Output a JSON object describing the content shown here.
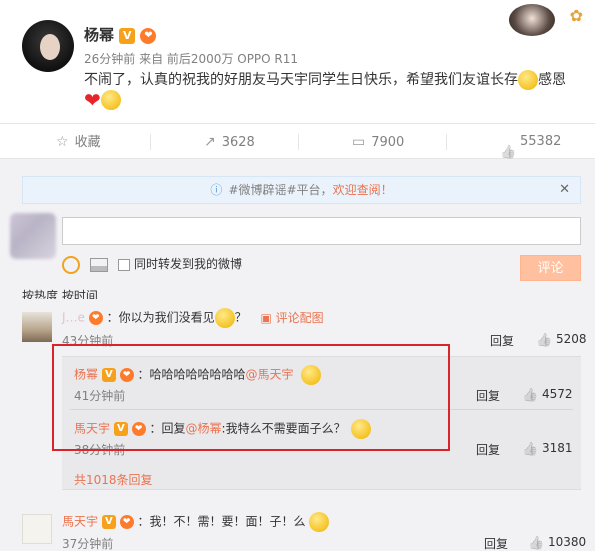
{
  "post": {
    "author": "杨幂",
    "v_badge": "V",
    "meta": "26分钟前 来自 前后2000万 OPPO R11",
    "text": "不闹了，认真的祝我的好朋友马天宇同学生日快乐，希望我们友谊长存",
    "text_tail": "感恩"
  },
  "actions": {
    "favorite": "收藏",
    "repost_count": "3628",
    "comment_count": "7900",
    "like_count": "55382"
  },
  "notice": {
    "text": "#微博辟谣#平台，",
    "link": "欢迎查阅！",
    "close": "✕"
  },
  "composer": {
    "placeholder": "",
    "repost_label": "同时转发到我的微博",
    "submit_label": "评论"
  },
  "tabs": {
    "label": "按热度    按时间"
  },
  "comments": [
    {
      "author": "J…e",
      "text": "：你以为我们没看见",
      "text_tail": "？",
      "pic_link": "评论配图",
      "time": "43分钟前",
      "reply": "回复",
      "likes": "5208"
    },
    {
      "author": "杨幂",
      "text": "：哈哈哈哈哈哈哈哈",
      "mention": "@馬天宇",
      "time": "41分钟前",
      "reply": "回复",
      "likes": "4572"
    },
    {
      "author": "馬天宇",
      "text_prefix": "：回复",
      "mention": "@杨幂",
      "text": ":我特么不需要面子么？",
      "time": "38分钟前",
      "reply": "回复",
      "likes": "3181"
    },
    {
      "author": "馬天宇",
      "text": "：我！不！需！要！面！子！么",
      "time": "37分钟前",
      "reply": "回复",
      "likes": "10380"
    }
  ],
  "more_replies": "共1018条回复",
  "colors": {
    "accent": "#eb7350",
    "highlight_border": "#d8252c",
    "submit_bg": "#ffc09f"
  }
}
